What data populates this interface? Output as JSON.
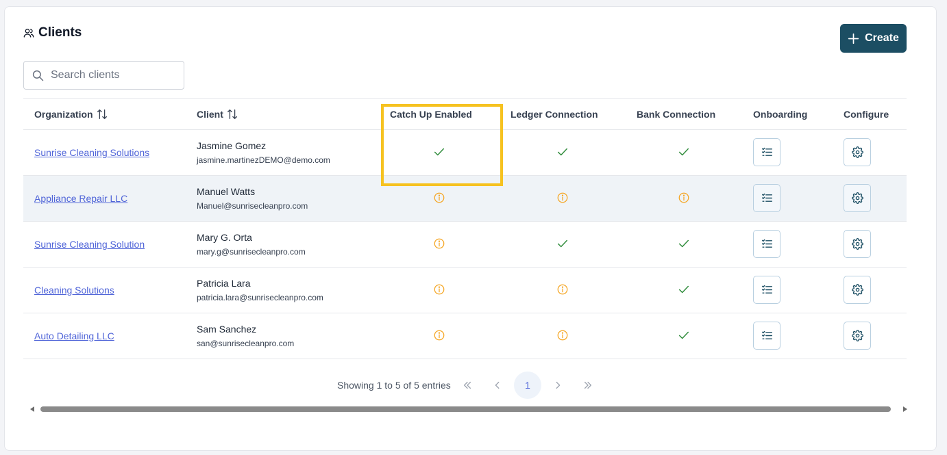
{
  "page": {
    "title": "Clients",
    "icon": "users-icon"
  },
  "toolbar": {
    "create_label": "Create"
  },
  "search": {
    "placeholder": "Search clients",
    "value": ""
  },
  "columns": {
    "organization": "Organization",
    "client": "Client",
    "catch_up": "Catch Up Enabled",
    "ledger": "Ledger Connection",
    "bank": "Bank Connection",
    "onboarding": "Onboarding",
    "configure": "Configure"
  },
  "rows": [
    {
      "organization": "Sunrise Cleaning Solutions",
      "client_name": "Jasmine Gomez",
      "email": "jasmine.martinezDEMO@demo.com",
      "catch_up": "check",
      "ledger": "check",
      "bank": "check"
    },
    {
      "organization": "Appliance Repair LLC",
      "client_name": "Manuel Watts",
      "email": "Manuel@sunrisecleanpro.com",
      "catch_up": "warning",
      "ledger": "warning",
      "bank": "warning"
    },
    {
      "organization": "Sunrise Cleaning Solution",
      "client_name": "Mary G. Orta",
      "email": "mary.g@sunrisecleanpro.com",
      "catch_up": "warning",
      "ledger": "check",
      "bank": "check"
    },
    {
      "organization": "Cleaning Solutions",
      "client_name": "Patricia Lara",
      "email": "patricia.lara@sunrisecleanpro.com",
      "catch_up": "warning",
      "ledger": "warning",
      "bank": "check"
    },
    {
      "organization": "Auto Detailing LLC",
      "client_name": "Sam Sanchez",
      "email": "san@sunrisecleanpro.com",
      "catch_up": "warning",
      "ledger": "warning",
      "bank": "check"
    }
  ],
  "pagination": {
    "info": "Showing 1 to 5 of 5 entries",
    "current_page": "1"
  },
  "colors": {
    "accent": "#1c4e63",
    "link": "#4f64d8",
    "check": "#2e8b3a",
    "warning": "#f5a623",
    "highlight": "#f6c220"
  }
}
